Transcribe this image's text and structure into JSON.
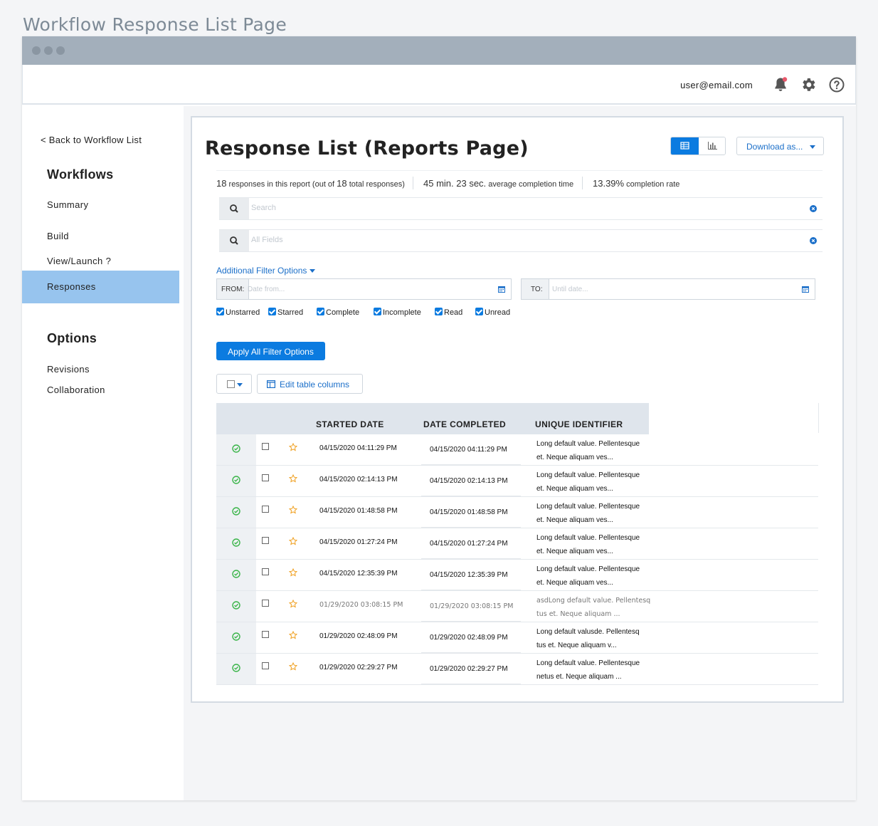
{
  "page_title": "Workflow Response List Page",
  "header": {
    "user_email": "user@email.com"
  },
  "sidebar": {
    "back_link": "< Back to Workflow List",
    "workflows_heading": "Workflows",
    "items": [
      {
        "label": "Summary"
      },
      {
        "label": "Build"
      },
      {
        "label": "View/Launch ?"
      },
      {
        "label": "Responses",
        "active": true
      }
    ],
    "options_heading": "Options",
    "option_items": [
      {
        "label": "Revisions"
      },
      {
        "label": "Collaboration"
      }
    ]
  },
  "main": {
    "title": "Response List (Reports Page)",
    "download_label": "Download as...",
    "stats": {
      "responses_count": "18",
      "responses_text_a": "responses in this report (out of",
      "responses_total": "18",
      "responses_text_b": "total responses)",
      "avg_time": "45 min. 23 sec.",
      "avg_time_label": "average completion time",
      "completion_rate": "13.39%",
      "completion_rate_label": "completion rate"
    },
    "search_placeholder": "Search",
    "fields_placeholder": "All Fields",
    "additional_filters_label": "Additional Filter Options",
    "from_label": "FROM:",
    "from_placeholder": "Date from...",
    "to_label": "TO:",
    "to_placeholder": "Until date...",
    "checkboxes": [
      {
        "label": "Unstarred",
        "checked": true
      },
      {
        "label": "Starred",
        "checked": true
      },
      {
        "label": "Complete",
        "checked": true
      },
      {
        "label": "Incomplete",
        "checked": true
      },
      {
        "label": "Read",
        "checked": true
      },
      {
        "label": "Unread",
        "checked": true
      }
    ],
    "apply_label": "Apply All Filter Options",
    "edit_columns_label": "Edit table columns",
    "table": {
      "headers": [
        "STARTED DATE",
        "DATE COMPLETED",
        "UNIQUE IDENTIFIER"
      ],
      "rows": [
        {
          "started": "04/15/2020 04:11:29 PM",
          "completed": "04/15/2020 04:11:29 PM",
          "uid_1": "Long default value. Pellentesque",
          "uid_2": "et. Neque aliquam ves..."
        },
        {
          "started": "04/15/2020 02:14:13 PM",
          "completed": "04/15/2020 02:14:13 PM",
          "uid_1": "Long default value. Pellentesque",
          "uid_2": "et. Neque aliquam ves..."
        },
        {
          "started": "04/15/2020 01:48:58 PM",
          "completed": "04/15/2020 01:48:58 PM",
          "uid_1": "Long default value. Pellentesque",
          "uid_2": "et. Neque aliquam ves..."
        },
        {
          "started": "04/15/2020 01:27:24 PM",
          "completed": "04/15/2020 01:27:24 PM",
          "uid_1": "Long default value. Pellentesque",
          "uid_2": "et. Neque aliquam ves..."
        },
        {
          "started": "04/15/2020 12:35:39 PM",
          "completed": "04/15/2020 12:35:39 PM",
          "uid_1": "Long default value. Pellentesque",
          "uid_2": "et. Neque aliquam ves..."
        },
        {
          "started": "01/29/2020 03:08:15 PM",
          "completed": "01/29/2020 03:08:15 PM",
          "uid_1": "asdLong default value. Pellentesq",
          "uid_2": "tus et. Neque aliquam ...",
          "light": true
        },
        {
          "started": "01/29/2020 02:48:09 PM",
          "completed": "01/29/2020 02:48:09 PM",
          "uid_1": "Long default valusde. Pellentesq",
          "uid_2": "tus et. Neque aliquam v..."
        },
        {
          "started": "01/29/2020 02:29:27 PM",
          "completed": "01/29/2020 02:29:27 PM",
          "uid_1": "Long default value. Pellentesque",
          "uid_2": "netus et. Neque aliquam ..."
        }
      ]
    }
  },
  "colors": {
    "accent": "#0b7be0",
    "active_nav": "#97c4ee",
    "titlebar": "#a3afbb",
    "success_check": "#3bb54a",
    "star": "#f0a020",
    "notification_dot": "#e8576a"
  }
}
